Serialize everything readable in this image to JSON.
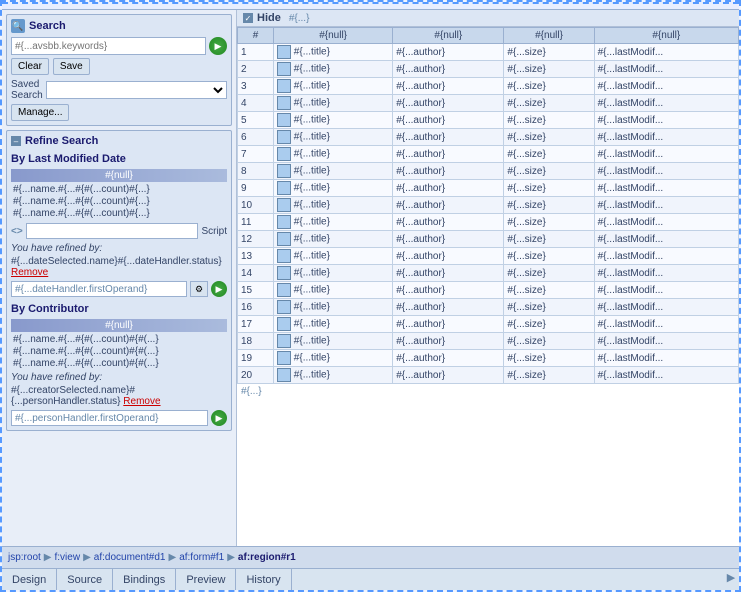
{
  "header": {
    "title": "Search",
    "dashed_border": true
  },
  "left_panel": {
    "search_section": {
      "title": "Search",
      "search_placeholder": "#{...avsbb.keywords}",
      "clear_btn": "Clear",
      "save_btn": "Save",
      "saved_search_label": "Saved Search",
      "manage_btn": "Manage..."
    },
    "refine_section": {
      "title": "Refine Search",
      "by_date_title": "By Last Modified Date",
      "null_label": "#{null}",
      "filter_items": [
        "#{...name.#{...#{#(...count)#{...}",
        "#{...name.#{...#{#(...count)#{...}",
        "#{...name.#{...#{#(...count)#{...}"
      ],
      "script_label": "Script",
      "refined_by_label": "You have refined by:",
      "refined_value": "#{...dateSelected.name}#{...dateHandler.status}",
      "remove_label": "Remove",
      "handler_input": "#{...dateHandler.firstOperand}",
      "by_contributor_title": "By Contributor",
      "contributor_null": "#{null}",
      "contributor_items": [
        "#{...name.#{...#{#(...count)#{#(...}",
        "#{...name.#{...#{#(...count)#{#(...}",
        "#{...name.#{...#{#(...count)#{#(...}"
      ],
      "contributor_refined_label": "You have refined by:",
      "contributor_refined_value": "#{...creatorSelected.name}#{...personHandler.status}",
      "contributor_remove": "Remove",
      "contributor_handler_input": "#{...personHandler.firstOperand}"
    }
  },
  "right_panel": {
    "hide_label": "Hide",
    "null_row_label": "#{...}",
    "columns": [
      {
        "id": "col_hash",
        "label": "#"
      },
      {
        "id": "col_null1",
        "label": "#{null}"
      },
      {
        "id": "col_null2",
        "label": "#{null}"
      },
      {
        "id": "col_null3",
        "label": "#{null}"
      },
      {
        "id": "col_null4",
        "label": "#{null}"
      }
    ],
    "rows": [
      {
        "title": "#{...title}",
        "author": "#{...author}",
        "size": "#{...size}",
        "lastmod": "#{...lastModif..."
      },
      {
        "title": "#{...title}",
        "author": "#{...author}",
        "size": "#{...size}",
        "lastmod": "#{...lastModif..."
      },
      {
        "title": "#{...title}",
        "author": "#{...author}",
        "size": "#{...size}",
        "lastmod": "#{...lastModif..."
      },
      {
        "title": "#{...title}",
        "author": "#{...author}",
        "size": "#{...size}",
        "lastmod": "#{...lastModif..."
      },
      {
        "title": "#{...title}",
        "author": "#{...author}",
        "size": "#{...size}",
        "lastmod": "#{...lastModif..."
      },
      {
        "title": "#{...title}",
        "author": "#{...author}",
        "size": "#{...size}",
        "lastmod": "#{...lastModif..."
      },
      {
        "title": "#{...title}",
        "author": "#{...author}",
        "size": "#{...size}",
        "lastmod": "#{...lastModif..."
      },
      {
        "title": "#{...title}",
        "author": "#{...author}",
        "size": "#{...size}",
        "lastmod": "#{...lastModif..."
      },
      {
        "title": "#{...title}",
        "author": "#{...author}",
        "size": "#{...size}",
        "lastmod": "#{...lastModif..."
      },
      {
        "title": "#{...title}",
        "author": "#{...author}",
        "size": "#{...size}",
        "lastmod": "#{...lastModif..."
      },
      {
        "title": "#{...title}",
        "author": "#{...author}",
        "size": "#{...size}",
        "lastmod": "#{...lastModif..."
      },
      {
        "title": "#{...title}",
        "author": "#{...author}",
        "size": "#{...size}",
        "lastmod": "#{...lastModif..."
      },
      {
        "title": "#{...title}",
        "author": "#{...author}",
        "size": "#{...size}",
        "lastmod": "#{...lastModif..."
      },
      {
        "title": "#{...title}",
        "author": "#{...author}",
        "size": "#{...size}",
        "lastmod": "#{...lastModif..."
      },
      {
        "title": "#{...title}",
        "author": "#{...author}",
        "size": "#{...size}",
        "lastmod": "#{...lastModif..."
      },
      {
        "title": "#{...title}",
        "author": "#{...author}",
        "size": "#{...size}",
        "lastmod": "#{...lastModif..."
      },
      {
        "title": "#{...title}",
        "author": "#{...author}",
        "size": "#{...size}",
        "lastmod": "#{...lastModif..."
      },
      {
        "title": "#{...title}",
        "author": "#{...author}",
        "size": "#{...size}",
        "lastmod": "#{...lastModif..."
      },
      {
        "title": "#{...title}",
        "author": "#{...author}",
        "size": "#{...size}",
        "lastmod": "#{...lastModif..."
      },
      {
        "title": "#{...title}",
        "author": "#{...author}",
        "size": "#{...size}",
        "lastmod": "#{...lastModif..."
      }
    ],
    "footer_label": "#{...}"
  },
  "breadcrumb": {
    "items": [
      "jsp:root",
      "f:view",
      "af:document#d1",
      "af:form#f1"
    ],
    "current": "af:region#r1"
  },
  "bottom_tabs": {
    "tabs": [
      {
        "id": "design",
        "label": "Design",
        "active": false
      },
      {
        "id": "source",
        "label": "Source",
        "active": false
      },
      {
        "id": "bindings",
        "label": "Bindings",
        "active": false
      },
      {
        "id": "preview",
        "label": "Preview",
        "active": false
      },
      {
        "id": "history",
        "label": "History",
        "active": false
      }
    ]
  }
}
